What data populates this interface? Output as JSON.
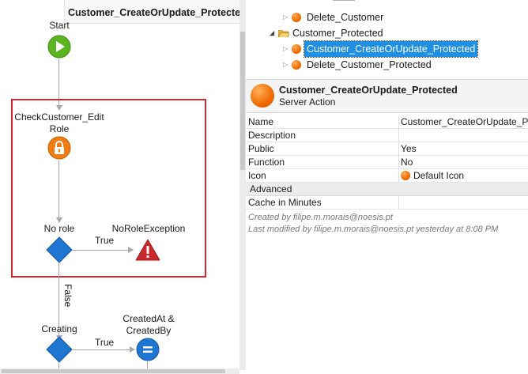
{
  "canvas": {
    "title": "Customer_CreateOrUpdate_Protected",
    "nodes": {
      "start": "Start",
      "check_role": "CheckCustomer_Edit\nRole",
      "check_role_line1": "CheckCustomer_Edit",
      "check_role_line2": "Role",
      "no_role": "No role",
      "no_role_exception": "NoRoleException",
      "creating": "Creating",
      "created_line1": "CreatedAt &",
      "created_line2": "CreatedBy"
    },
    "edges": {
      "true1": "True",
      "false1": "False",
      "true2": "True"
    }
  },
  "tree": {
    "items": [
      {
        "label": "Delete_Customer",
        "type": "action"
      },
      {
        "label": "Customer_Protected",
        "type": "folder"
      },
      {
        "label": "Customer_CreateOrUpdate_Protected",
        "type": "action",
        "selected": true
      },
      {
        "label": "Delete_Customer_Protected",
        "type": "action"
      }
    ]
  },
  "properties": {
    "title": "Customer_CreateOrUpdate_Protected",
    "subtitle": "Server Action",
    "rows": [
      {
        "key": "Name",
        "value": "Customer_CreateOrUpdate_Pro"
      },
      {
        "key": "Description",
        "value": ""
      },
      {
        "key": "Public",
        "value": "Yes"
      },
      {
        "key": "Function",
        "value": "No"
      },
      {
        "key": "Icon",
        "value": "Default Icon"
      }
    ],
    "section": "Advanced",
    "advanced_rows": [
      {
        "key": "Cache in Minutes",
        "value": ""
      }
    ],
    "created_by": "Created by filipe.m.morais@noesis.pt",
    "modified_by": "Last modified by filipe.m.morais@noesis.pt yesterday at 8:08 PM"
  },
  "colors": {
    "start_green": "#5bb521",
    "security_orange": "#f07d14",
    "decision_blue": "#1f76d2",
    "exception_red": "#c9282d",
    "highlight_red": "#d9262e",
    "selection_blue": "#1e8fe3"
  },
  "icons": {
    "start": "play-icon",
    "check_role": "lock-icon",
    "decision": "diamond-icon",
    "exception": "warning-icon",
    "assign": "equals-icon"
  }
}
